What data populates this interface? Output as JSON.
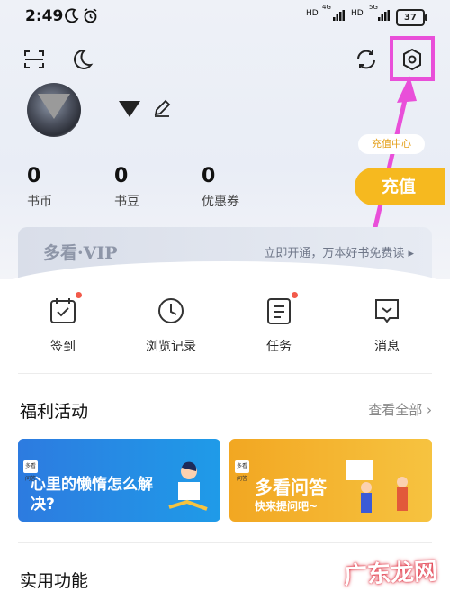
{
  "status_bar": {
    "time": "2:49",
    "network_1": "4G",
    "network_2": "5G",
    "battery": "37"
  },
  "profile": {
    "stats": [
      {
        "value": "0",
        "label": "书币"
      },
      {
        "value": "0",
        "label": "书豆"
      },
      {
        "value": "0",
        "label": "优惠券"
      }
    ],
    "recharge_center": "充值中心",
    "recharge_button": "充值"
  },
  "vip": {
    "title": "多看·VIP",
    "promo": "立即开通，万本好书免费读 ▸"
  },
  "quick_actions": [
    {
      "label": "签到"
    },
    {
      "label": "浏览记录"
    },
    {
      "label": "任务"
    },
    {
      "label": "消息"
    }
  ],
  "welfare": {
    "title": "福利活动",
    "see_all": "查看全部 ›",
    "banners": [
      {
        "title": "心里的懒惰怎么解决?",
        "tag": "多看问答"
      },
      {
        "title": "多看问答",
        "subtitle": "快来提问吧~",
        "tag": "多看问答"
      }
    ]
  },
  "utilities": {
    "title": "实用功能"
  },
  "watermark": "广东龙网",
  "colors": {
    "accent_yellow": "#f6b91f",
    "annotation": "#e94fd9",
    "dot_red": "#f25a4a"
  },
  "icons": [
    "moon-icon",
    "alarm-icon",
    "scan-icon",
    "night-mode-icon",
    "sync-icon",
    "settings-icon",
    "edit-icon",
    "checkin-icon",
    "history-icon",
    "task-icon",
    "message-icon",
    "chevron-right-icon"
  ]
}
